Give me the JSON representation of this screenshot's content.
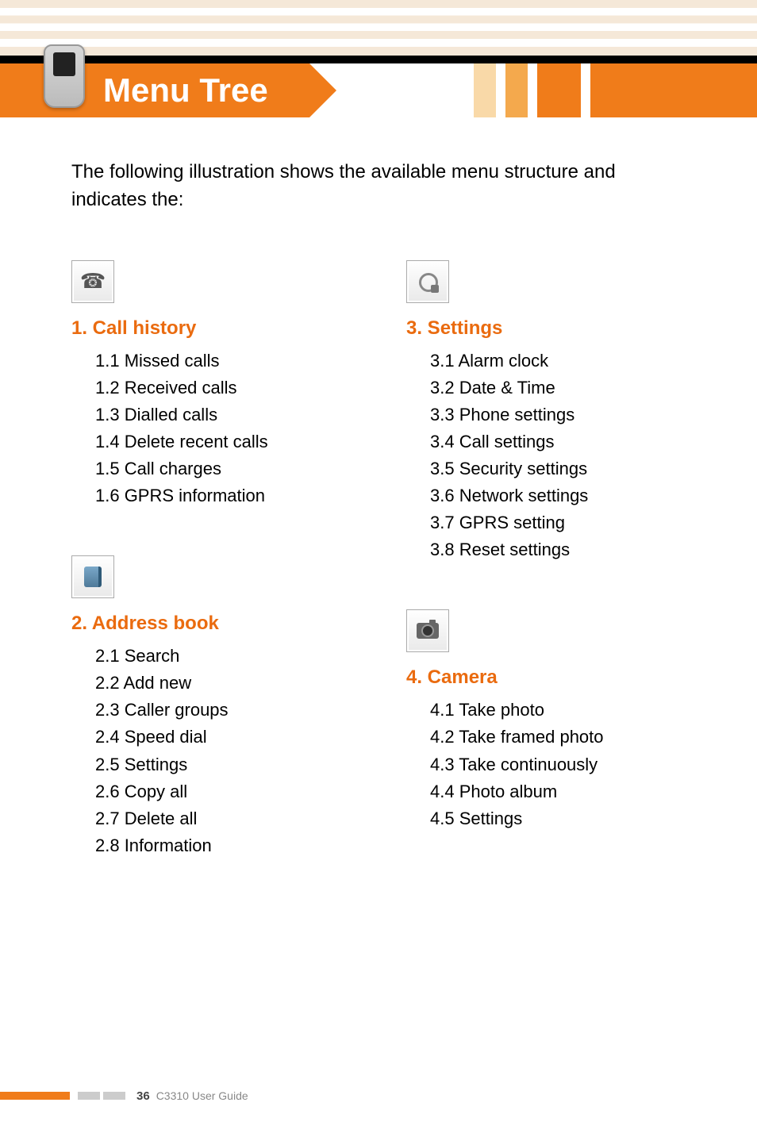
{
  "header": {
    "title": "Menu Tree"
  },
  "intro": "The following illustration shows the available menu structure and indicates the:",
  "menus": {
    "section1": {
      "title": "1. Call history",
      "icon": "phone-icon",
      "items": [
        "1.1 Missed calls",
        "1.2 Received calls",
        "1.3 Dialled calls",
        "1.4 Delete recent calls",
        "1.5 Call charges",
        "1.6 GPRS information"
      ]
    },
    "section2": {
      "title": "2. Address book",
      "icon": "addressbook-icon",
      "items": [
        "2.1 Search",
        "2.2 Add new",
        "2.3 Caller groups",
        "2.4 Speed dial",
        "2.5 Settings",
        "2.6 Copy all",
        "2.7 Delete all",
        "2.8 Information"
      ]
    },
    "section3": {
      "title": "3. Settings",
      "icon": "settings-icon",
      "items": [
        "3.1 Alarm clock",
        "3.2 Date & Time",
        "3.3 Phone settings",
        "3.4 Call settings",
        "3.5 Security settings",
        "3.6 Network settings",
        "3.7 GPRS setting",
        "3.8 Reset settings"
      ]
    },
    "section4": {
      "title": "4. Camera",
      "icon": "camera-icon",
      "items": [
        "4.1 Take photo",
        "4.2 Take framed photo",
        "4.3 Take continuously",
        "4.4 Photo album",
        "4.5 Settings"
      ]
    }
  },
  "footer": {
    "page_number": "36",
    "doc_title": "C3310 User Guide"
  }
}
